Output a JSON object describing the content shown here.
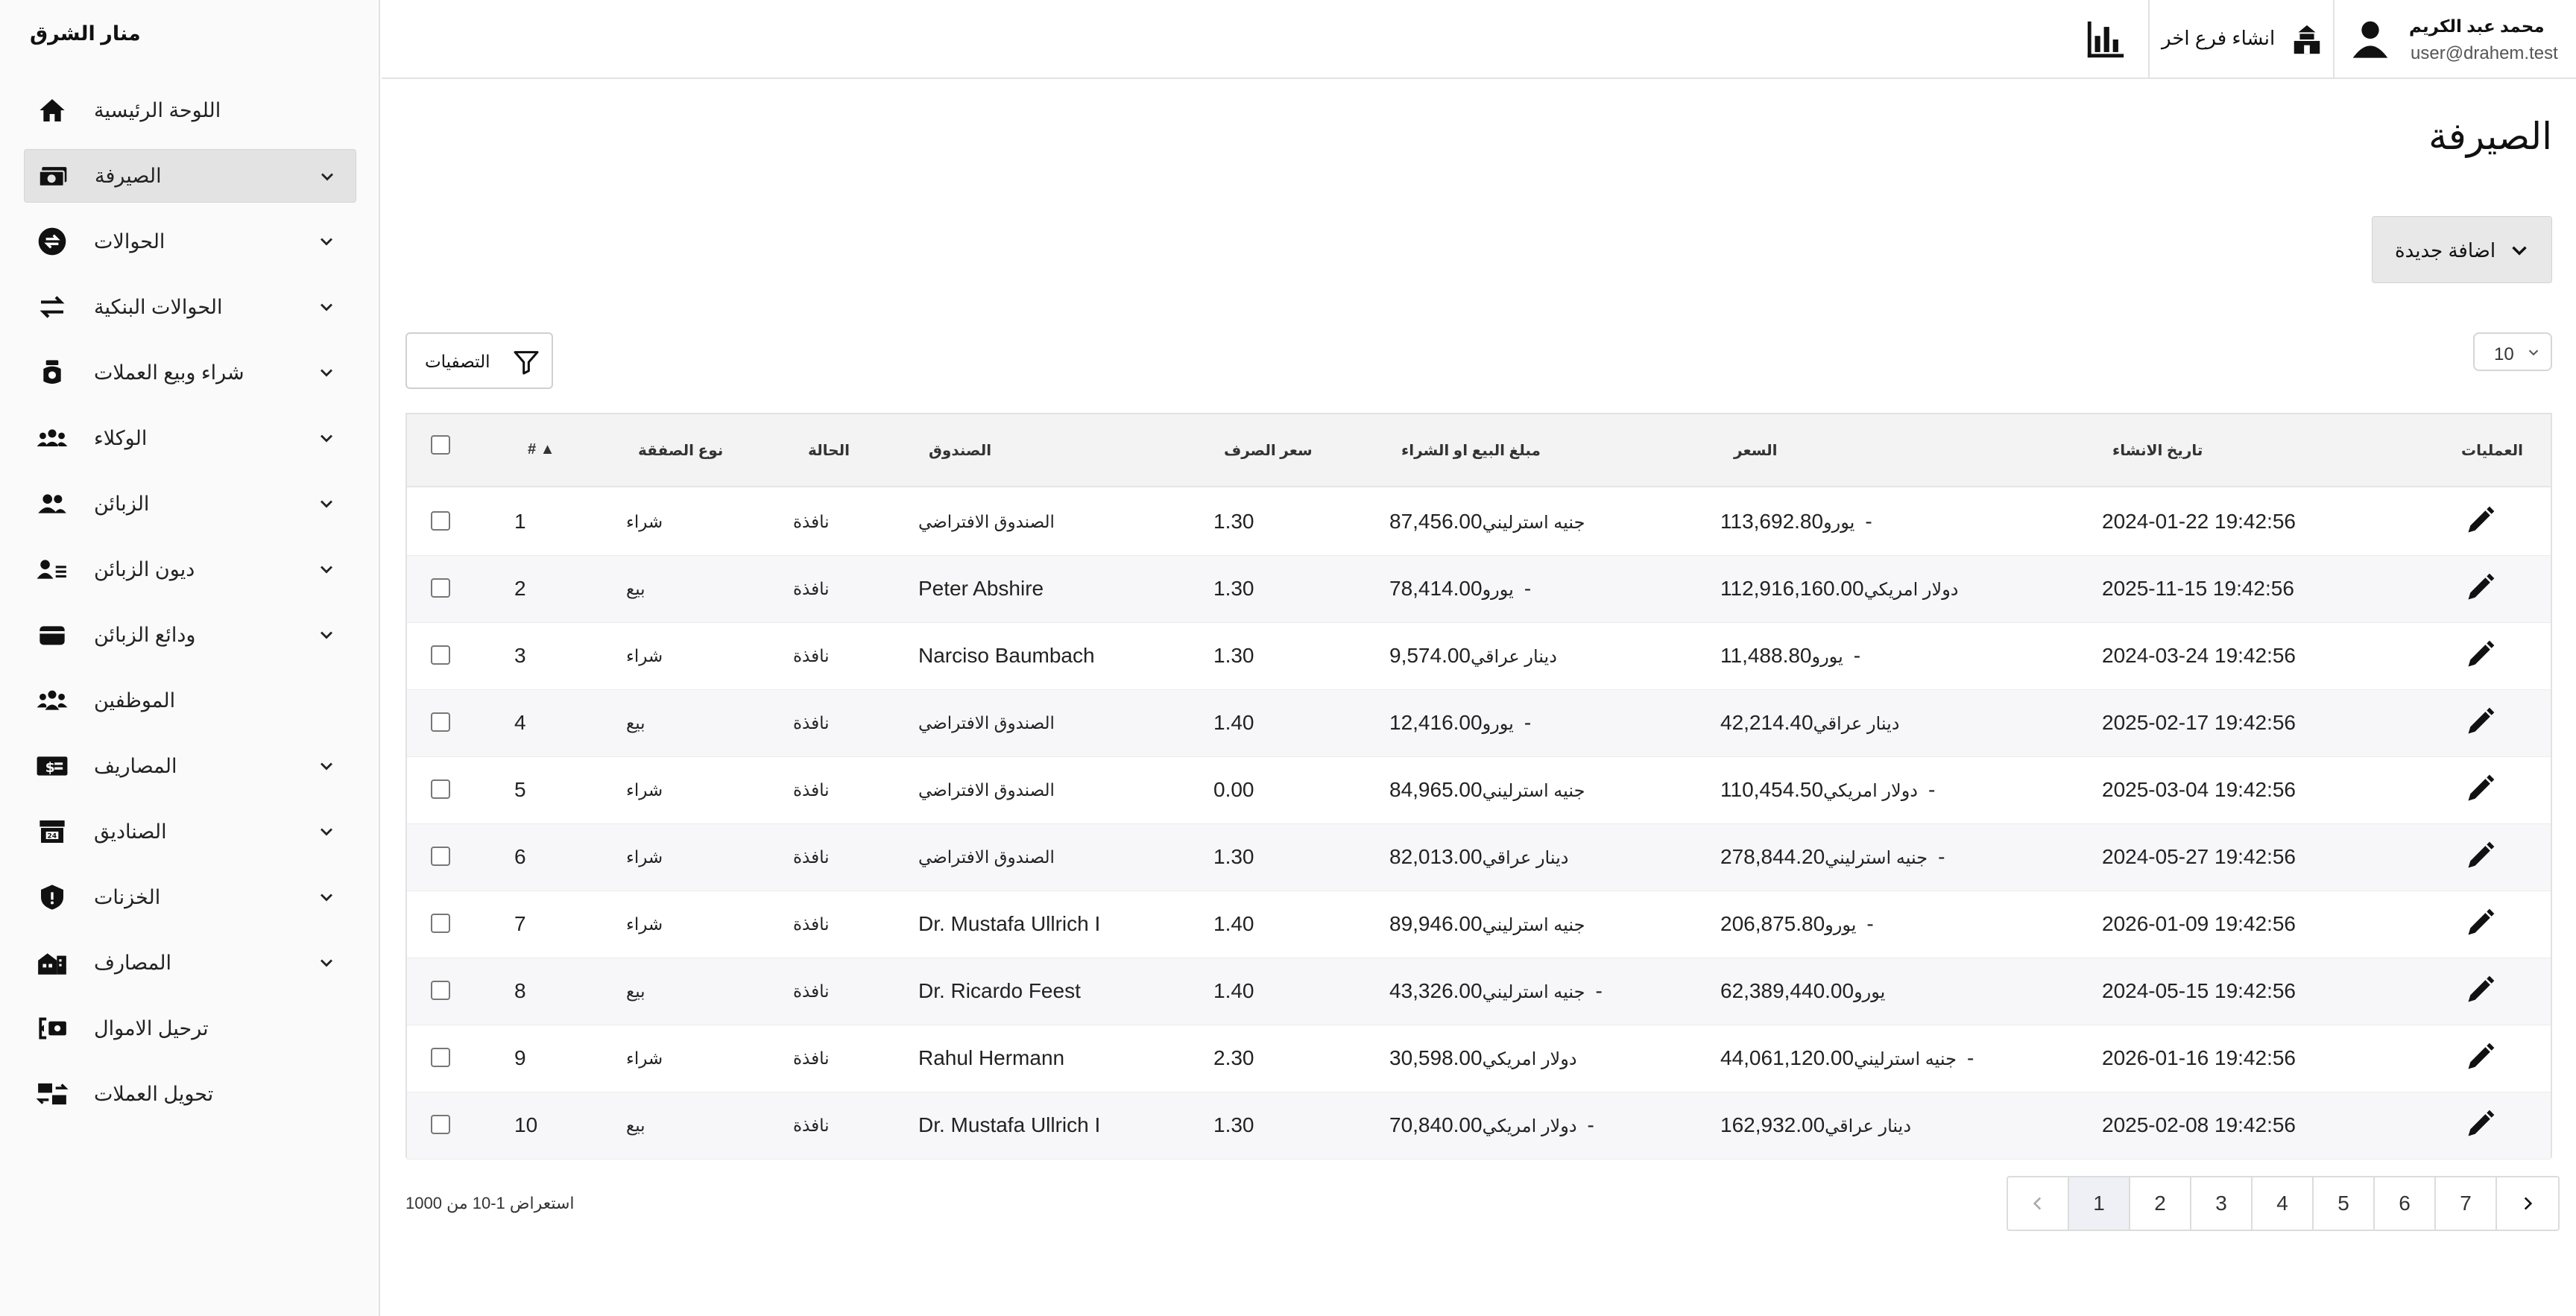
{
  "app": {
    "brand": "منار الشرق"
  },
  "sidebar": {
    "items": [
      {
        "label": "اللوحة الرئيسية",
        "icon": "home-icon",
        "expandable": false,
        "active": false
      },
      {
        "label": "الصيرفة",
        "icon": "money-icon",
        "expandable": true,
        "active": true
      },
      {
        "label": "الحوالات",
        "icon": "exchange-circle-icon",
        "expandable": true,
        "active": false
      },
      {
        "label": "الحوالات البنكية",
        "icon": "transfer-arrows-icon",
        "expandable": true,
        "active": false
      },
      {
        "label": "شراء وبيع العملات",
        "icon": "coins-bag-icon",
        "expandable": true,
        "active": false
      },
      {
        "label": "الوكلاء",
        "icon": "group-icon",
        "expandable": true,
        "active": false
      },
      {
        "label": "الزبائن",
        "icon": "users-icon",
        "expandable": true,
        "active": false
      },
      {
        "label": "ديون الزبائن",
        "icon": "user-list-icon",
        "expandable": true,
        "active": false
      },
      {
        "label": "ودائع الزبائن",
        "icon": "wallet-icon",
        "expandable": true,
        "active": false
      },
      {
        "label": "الموظفين",
        "icon": "team-icon",
        "expandable": false,
        "active": false
      },
      {
        "label": "المصاريف",
        "icon": "expense-icon",
        "expandable": true,
        "active": false
      },
      {
        "label": "الصناديق",
        "icon": "store-icon",
        "expandable": true,
        "active": false
      },
      {
        "label": "الخزنات",
        "icon": "shield-icon",
        "expandable": true,
        "active": false
      },
      {
        "label": "المصارف",
        "icon": "bank-building-icon",
        "expandable": true,
        "active": false
      },
      {
        "label": "ترحيل الاموال",
        "icon": "money-transfer-icon",
        "expandable": false,
        "active": false
      },
      {
        "label": "تحويل العملات",
        "icon": "currency-convert-icon",
        "expandable": false,
        "active": false
      }
    ]
  },
  "topbar": {
    "user_name": "محمد عبد الكريم",
    "user_email": "user@drahem.test",
    "create_branch_label": "انشاء فرع اخر"
  },
  "page": {
    "title": "الصيرفة",
    "add_new_label": "اضافة جديدة",
    "filters_label": "التصفيات",
    "page_size": "10"
  },
  "table": {
    "headers": {
      "actions": "العمليات",
      "created_at": "تاريخ الانشاء",
      "price": "السعر",
      "amount": "مبلغ البيع او الشراء",
      "rate": "سعر الصرف",
      "fund": "الصندوق",
      "status": "الحالة",
      "type": "نوع الصفقة",
      "id": "# ▲"
    },
    "rows": [
      {
        "id": "1",
        "type": "شراء",
        "status": "نافذة",
        "fund": "الصندوق الافتراضي",
        "rate": "1.30",
        "amount": "87,456.00",
        "amount_cur": "جنيه استرليني",
        "price": "113,692.80-",
        "price_cur": "يورو",
        "date": "2024-01-22 19:42:56"
      },
      {
        "id": "2",
        "type": "بيع",
        "status": "نافذة",
        "fund": "Peter Abshire",
        "rate": "1.30",
        "amount": "78,414.00-",
        "amount_cur": "يورو",
        "price": "112,916,160.00",
        "price_cur": "دولار امريكي",
        "date": "2025-11-15 19:42:56"
      },
      {
        "id": "3",
        "type": "شراء",
        "status": "نافذة",
        "fund": "Narciso Baumbach",
        "rate": "1.30",
        "amount": "9,574.00",
        "amount_cur": "دينار عراقي",
        "price": "11,488.80-",
        "price_cur": "يورو",
        "date": "2024-03-24 19:42:56"
      },
      {
        "id": "4",
        "type": "بيع",
        "status": "نافذة",
        "fund": "الصندوق الافتراضي",
        "rate": "1.40",
        "amount": "12,416.00-",
        "amount_cur": "يورو",
        "price": "42,214.40",
        "price_cur": "دينار عراقي",
        "date": "2025-02-17 19:42:56"
      },
      {
        "id": "5",
        "type": "شراء",
        "status": "نافذة",
        "fund": "الصندوق الافتراضي",
        "rate": "0.00",
        "amount": "84,965.00",
        "amount_cur": "جنيه استرليني",
        "price": "110,454.50-",
        "price_cur": "دولار امريكي",
        "date": "2025-03-04 19:42:56"
      },
      {
        "id": "6",
        "type": "شراء",
        "status": "نافذة",
        "fund": "الصندوق الافتراضي",
        "rate": "1.30",
        "amount": "82,013.00",
        "amount_cur": "دينار عراقي",
        "price": "278,844.20-",
        "price_cur": "جنيه استرليني",
        "date": "2024-05-27 19:42:56"
      },
      {
        "id": "7",
        "type": "شراء",
        "status": "نافذة",
        "fund": "Dr. Mustafa Ullrich I",
        "rate": "1.40",
        "amount": "89,946.00",
        "amount_cur": "جنيه استرليني",
        "price": "206,875.80-",
        "price_cur": "يورو",
        "date": "2026-01-09 19:42:56"
      },
      {
        "id": "8",
        "type": "بيع",
        "status": "نافذة",
        "fund": "Dr. Ricardo Feest",
        "rate": "1.40",
        "amount": "43,326.00-",
        "amount_cur": "جنيه استرليني",
        "price": "62,389,440.00",
        "price_cur": "يورو",
        "date": "2024-05-15 19:42:56"
      },
      {
        "id": "9",
        "type": "شراء",
        "status": "نافذة",
        "fund": "Rahul Hermann",
        "rate": "2.30",
        "amount": "30,598.00",
        "amount_cur": "دولار امريكي",
        "price": "44,061,120.00-",
        "price_cur": "جنيه استرليني",
        "date": "2026-01-16 19:42:56"
      },
      {
        "id": "10",
        "type": "بيع",
        "status": "نافذة",
        "fund": "Dr. Mustafa Ullrich I",
        "rate": "1.30",
        "amount": "70,840.00-",
        "amount_cur": "دولار امريكي",
        "price": "162,932.00",
        "price_cur": "دينار عراقي",
        "date": "2025-02-08 19:42:56"
      }
    ]
  },
  "footer": {
    "showing": "استعراض 1-10 من 1000",
    "pages": [
      "7",
      "6",
      "5",
      "4",
      "3",
      "2",
      "1"
    ],
    "active_page": "1"
  },
  "colors": {
    "active_nav": "#e3e3e3",
    "header_bg": "#f3f3f3",
    "alt_row": "#f7f7f9"
  }
}
